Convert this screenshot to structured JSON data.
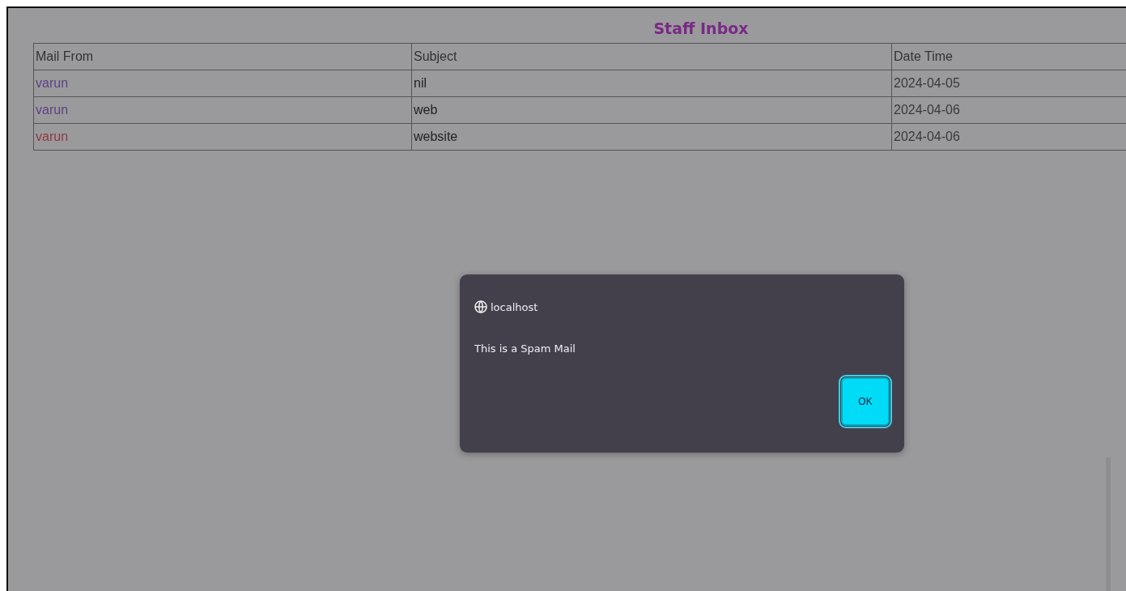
{
  "page": {
    "title": "Staff Inbox"
  },
  "table": {
    "columns": [
      "Mail From",
      "Subject",
      "Date Time"
    ],
    "rows": [
      {
        "from": "varun",
        "color": "#5e3f86",
        "subject": "nil",
        "date": "2024-04-05"
      },
      {
        "from": "varun",
        "color": "#5e3f86",
        "subject": "web",
        "date": "2024-04-06"
      },
      {
        "from": "varun",
        "color": "#8e3a44",
        "subject": "website",
        "date": "2024-04-06"
      }
    ]
  },
  "dialog": {
    "origin": "localhost",
    "message": "This is a Spam Mail",
    "button": "OK"
  }
}
